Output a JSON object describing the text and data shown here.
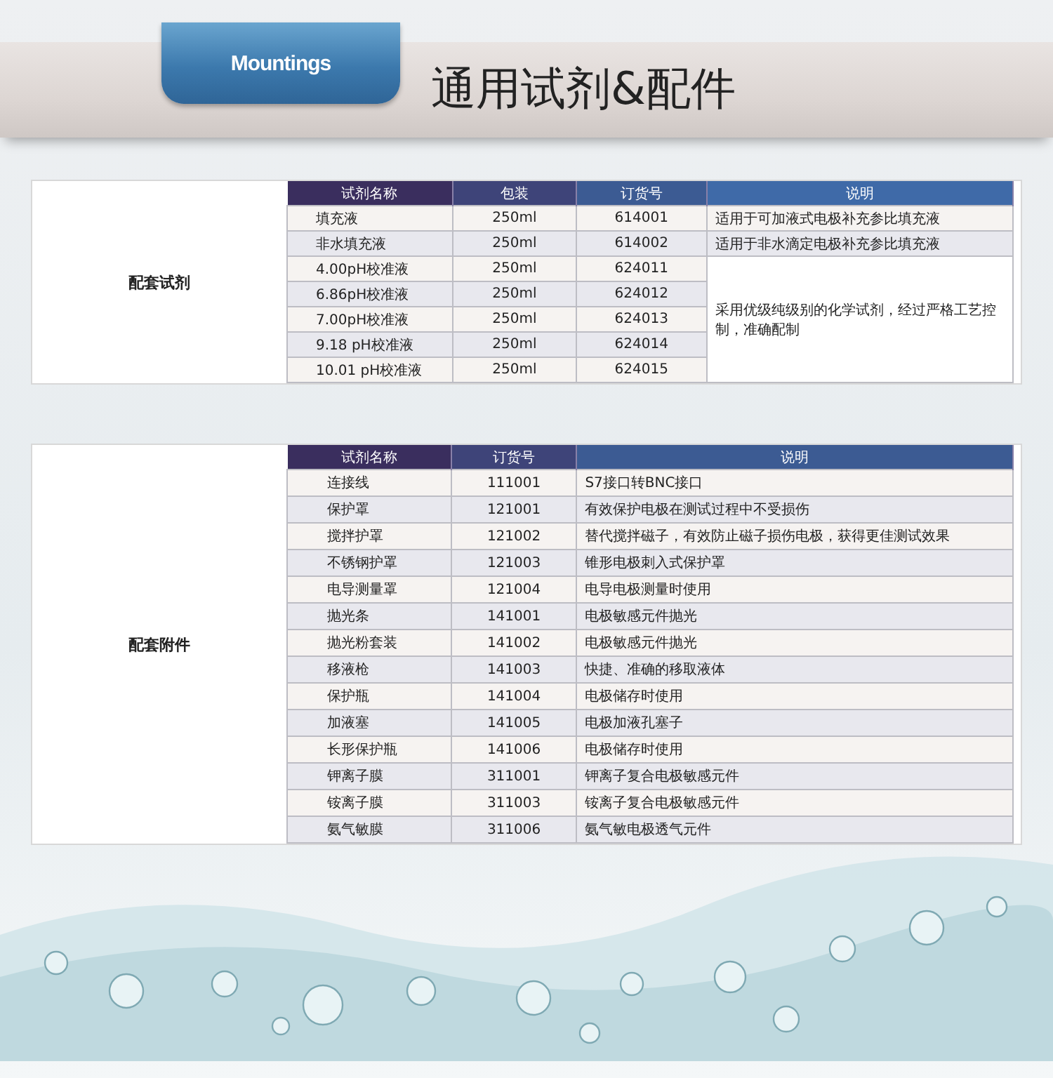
{
  "header": {
    "ribbon": "Mountings",
    "title": "通用试剂&配件"
  },
  "sections": [
    {
      "label": "配套试剂",
      "columns": [
        "试剂名称",
        "包装",
        "订货号",
        "说明"
      ],
      "groups": [
        {
          "description": "适用于可加液式电极补充参比填充液",
          "rows": [
            [
              "填充液",
              "250ml",
              "614001"
            ]
          ]
        },
        {
          "description": "适用于非水滴定电极补充参比填充液",
          "rows": [
            [
              "非水填充液",
              "250ml",
              "614002"
            ]
          ]
        },
        {
          "description": "采用优级纯级别的化学试剂，经过严格工艺控制，准确配制",
          "rows": [
            [
              "4.00pH校准液",
              "250ml",
              "624011"
            ],
            [
              "6.86pH校准液",
              "250ml",
              "624012"
            ],
            [
              "7.00pH校准液",
              "250ml",
              "624013"
            ],
            [
              "9.18 pH校准液",
              "250ml",
              "624014"
            ],
            [
              "10.01 pH校准液",
              "250ml",
              "624015"
            ]
          ]
        }
      ]
    },
    {
      "label": "配套附件",
      "columns": [
        "试剂名称",
        "订货号",
        "说明"
      ],
      "groups": [
        {
          "description": "S7接口转BNC接口",
          "rows": [
            [
              "连接线",
              "111001"
            ]
          ]
        },
        {
          "description": "有效保护电极在测试过程中不受损伤",
          "rows": [
            [
              "保护罩",
              "121001"
            ]
          ]
        },
        {
          "description": "替代搅拌磁子，有效防止磁子损伤电极，获得更佳测试效果",
          "rows": [
            [
              "搅拌护罩",
              "121002"
            ]
          ]
        },
        {
          "description": "锥形电极刺入式保护罩",
          "rows": [
            [
              "不锈钢护罩",
              "121003"
            ]
          ]
        },
        {
          "description": "电导电极测量时使用",
          "rows": [
            [
              "电导测量罩",
              "121004"
            ]
          ]
        },
        {
          "description": "电极敏感元件抛光",
          "rows": [
            [
              "抛光条",
              "141001"
            ]
          ]
        },
        {
          "description": "电极敏感元件抛光",
          "rows": [
            [
              "抛光粉套装",
              "141002"
            ]
          ]
        },
        {
          "description": "快捷、准确的移取液体",
          "rows": [
            [
              "移液枪",
              "141003"
            ]
          ]
        },
        {
          "description": "电极储存时使用",
          "rows": [
            [
              "保护瓶",
              "141004"
            ]
          ]
        },
        {
          "description": "电极加液孔塞子",
          "rows": [
            [
              "加液塞",
              "141005"
            ]
          ]
        },
        {
          "description": "电极储存时使用",
          "rows": [
            [
              "长形保护瓶",
              "141006"
            ]
          ]
        },
        {
          "description": "钾离子复合电极敏感元件",
          "rows": [
            [
              "钾离子膜",
              "311001"
            ]
          ]
        },
        {
          "description": "铵离子复合电极敏感元件",
          "rows": [
            [
              "铵离子膜",
              "311003"
            ]
          ]
        },
        {
          "description": "氨气敏电极透气元件",
          "rows": [
            [
              "氨气敏膜",
              "311006"
            ]
          ]
        }
      ]
    }
  ]
}
